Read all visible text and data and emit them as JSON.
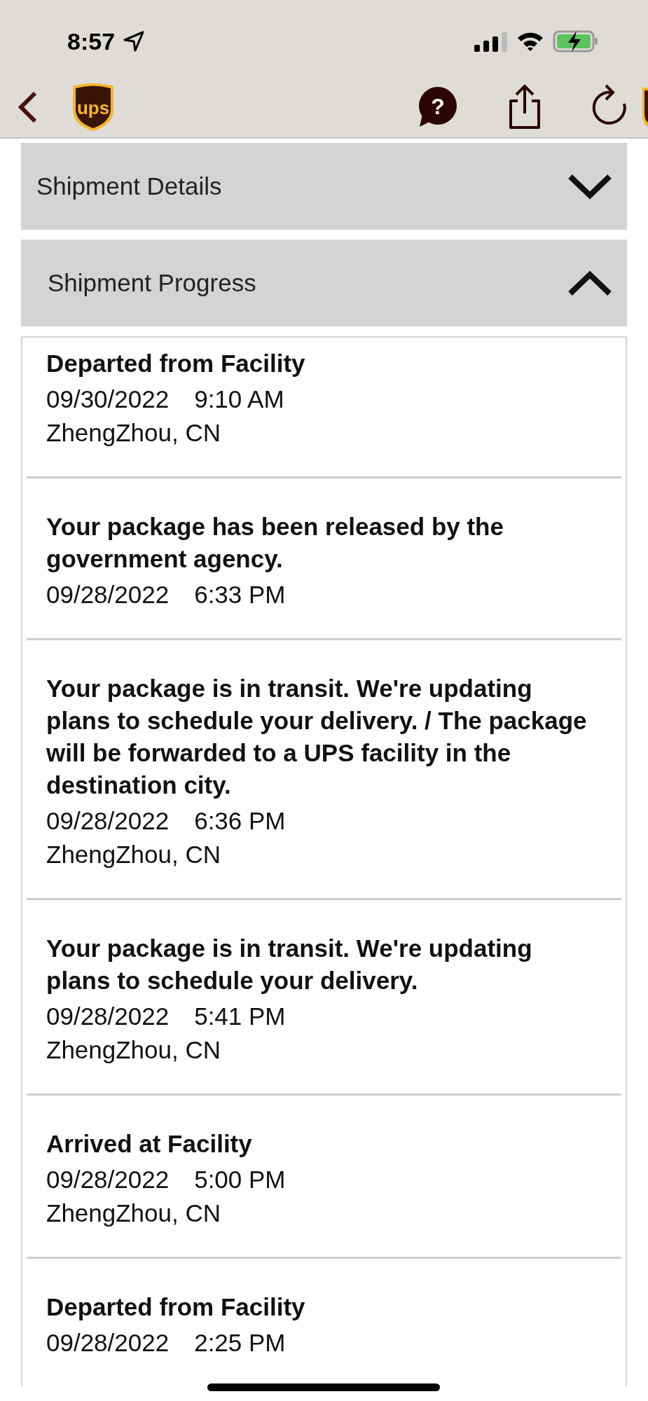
{
  "status_bar": {
    "time": "8:57"
  },
  "nav": {
    "logo_text": "ups",
    "help_label": "?"
  },
  "sections": [
    {
      "title": "Shipment Details",
      "expanded": false
    },
    {
      "title": "Shipment Progress",
      "expanded": true
    }
  ],
  "events": [
    {
      "title": "Departed from Facility",
      "date": "09/30/2022",
      "time": "9:10 AM",
      "location": "ZhengZhou, CN"
    },
    {
      "title": "Your package has been released by the government agency.",
      "date": "09/28/2022",
      "time": "6:33 PM"
    },
    {
      "title": "Your package is in transit. We're updating plans to schedule your delivery. / The package will be forwarded to a UPS facility in the destination city.",
      "date": "09/28/2022",
      "time": "6:36 PM",
      "location": "ZhengZhou, CN"
    },
    {
      "title": "Your package is in transit. We're updating plans to schedule your delivery.",
      "date": "09/28/2022",
      "time": "5:41 PM",
      "location": "ZhengZhou, CN"
    },
    {
      "title": "Arrived at Facility",
      "date": "09/28/2022",
      "time": "5:00 PM",
      "location": "ZhengZhou, CN"
    },
    {
      "title": "Departed from Facility",
      "date": "09/28/2022",
      "time": "2:25 PM"
    }
  ]
}
